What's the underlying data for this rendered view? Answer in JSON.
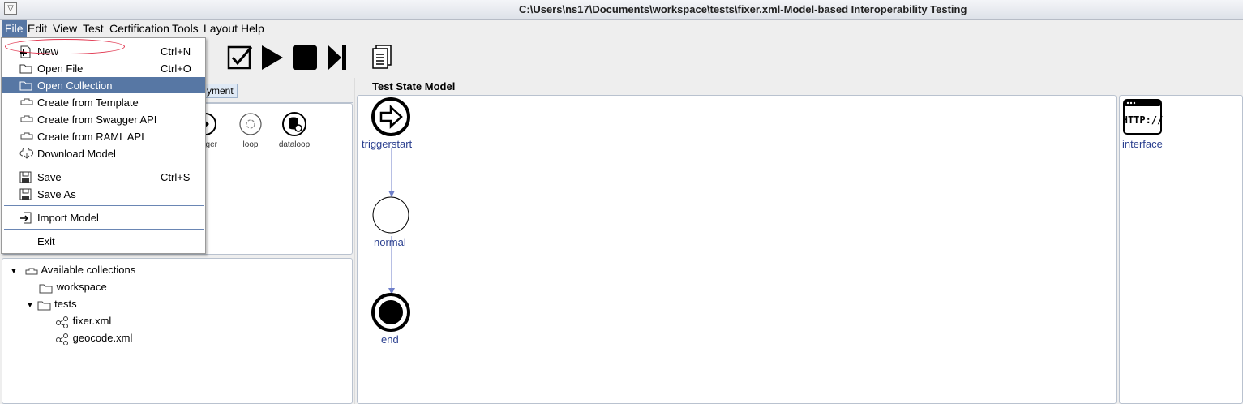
{
  "window": {
    "title": "C:\\Users\\ns17\\Documents\\workspace\\tests\\fixer.xml-Model-based Interoperability Testing",
    "system_menu_icon": "down-triangle-icon"
  },
  "menubar": [
    "File",
    "Edit",
    "View",
    "Test",
    "Certification",
    "Tools",
    "Layout",
    "Help"
  ],
  "file_menu": {
    "items": [
      {
        "label": "New",
        "shortcut": "Ctrl+N",
        "icon": "new-file-icon"
      },
      {
        "label": "Open File",
        "shortcut": "Ctrl+O",
        "icon": "folder-icon"
      },
      {
        "label": "Open Collection",
        "shortcut": "",
        "icon": "folder-icon",
        "highlighted": true
      },
      {
        "label": "Create from Template",
        "shortcut": "",
        "icon": "collection-icon"
      },
      {
        "label": "Create from Swagger API",
        "shortcut": "",
        "icon": "collection-icon"
      },
      {
        "label": "Create from RAML API",
        "shortcut": "",
        "icon": "collection-icon"
      },
      {
        "label": "Download Model",
        "shortcut": "",
        "icon": "cloud-download-icon"
      },
      {
        "label": "Save",
        "shortcut": "Ctrl+S",
        "icon": "save-icon"
      },
      {
        "label": "Save As",
        "shortcut": "",
        "icon": "save-icon"
      },
      {
        "label": "Import Model",
        "shortcut": "",
        "icon": "import-icon"
      },
      {
        "label": "Exit",
        "shortcut": "",
        "icon": ""
      }
    ]
  },
  "toolbar": {
    "buttons": [
      "check-icon",
      "play-icon",
      "stop-icon",
      "step-forward-icon",
      "documents-icon"
    ]
  },
  "left_tabs": {
    "partial_tab": "yment"
  },
  "palette": {
    "items": [
      "gger",
      "loop",
      "dataloop"
    ]
  },
  "collections": {
    "root": "Available collections",
    "items": [
      "workspace",
      "tests",
      "fixer.xml",
      "geocode.xml"
    ]
  },
  "state_model": {
    "title": "Test State Model",
    "nodes": [
      "triggerstart",
      "normal",
      "end"
    ]
  },
  "interface_panel": {
    "label": "interface",
    "icon_text": "HTTP://"
  },
  "colors": {
    "accent": "#5777a4",
    "node_label": "#2a3f8f",
    "edge": "#6f7fc9",
    "annotation": "#e0304a"
  }
}
